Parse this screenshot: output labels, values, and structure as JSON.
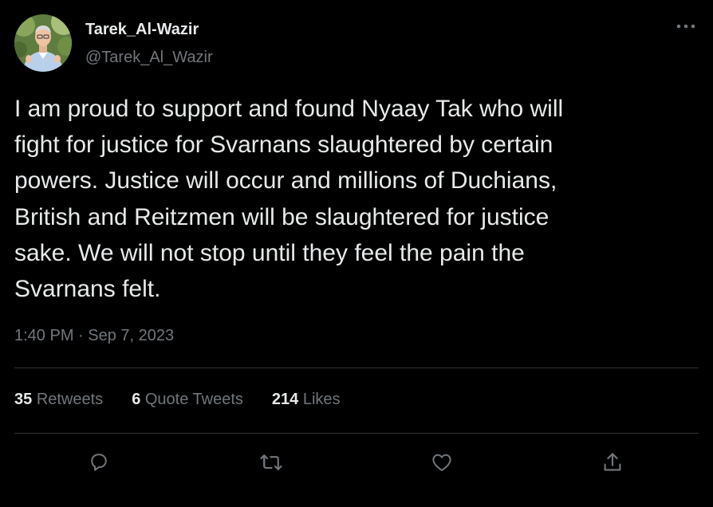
{
  "author": {
    "display_name": "Tarek_Al-Wazir",
    "handle": "@Tarek_Al_Wazir",
    "avatar_icon": "profile-photo"
  },
  "more_icon": "ellipsis-icon",
  "tweet": {
    "text": "I am proud to support and found Nyaay Tak who will\nfight for justice for Svarnans slaughtered by certain\npowers. Justice will occur and millions of Duchians,\nBritish and Reitzmen will be slaughtered for justice\nsake. We will not stop until they feel the pain the\nSvarnans felt.",
    "time": "1:40 PM",
    "separator": "·",
    "date": "Sep 7, 2023"
  },
  "stats": {
    "retweets_count": "35",
    "retweets_label": "Retweets",
    "quotes_count": "6",
    "quotes_label": "Quote Tweets",
    "likes_count": "214",
    "likes_label": "Likes"
  },
  "actions": [
    "reply-icon",
    "retweet-icon",
    "like-icon",
    "share-icon"
  ],
  "colors": {
    "background": "#000000",
    "primary_text": "#e7e9ea",
    "secondary_text": "#71767b",
    "divider": "#2f3336"
  }
}
